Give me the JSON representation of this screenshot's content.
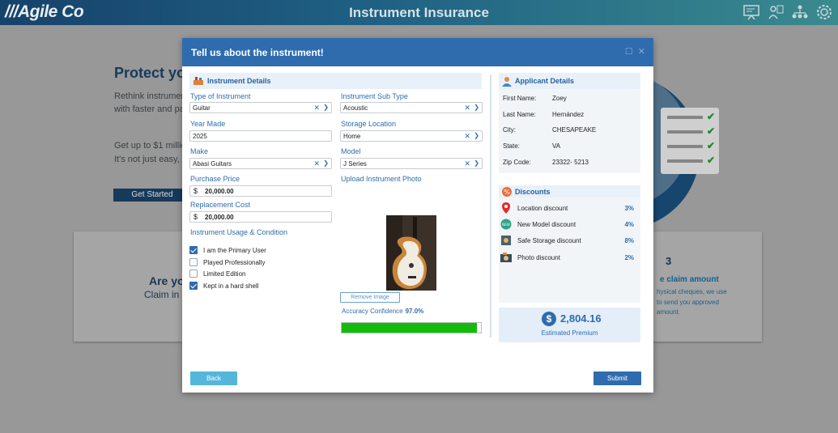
{
  "app": {
    "logo": "///Agile Co",
    "title": "Instrument Insurance"
  },
  "background": {
    "hero_title": "Protect yo",
    "hero_line1": "Rethink instrumer",
    "hero_line2": "with faster and pa",
    "hero_line3": "Get up to $1 millic",
    "hero_line4": "It's not just easy, i",
    "cta": "Get Started",
    "card_title": "Are yo",
    "card_sub": "Claim in",
    "step_num": "3",
    "step_title": "e claim amount",
    "step_line1": "hysical cheques, we use",
    "step_line2": "to send you approved",
    "step_line3": "amount."
  },
  "modal": {
    "title": "Tell us about the instrument!",
    "details": {
      "heading": "Instrument Details",
      "type_label": "Type of Instrument",
      "type_value": "Guitar",
      "subtype_label": "Instrument Sub Type",
      "subtype_value": "Acoustic",
      "year_label": "Year Made",
      "year_value": "2025",
      "storage_label": "Storage Location",
      "storage_value": "Home",
      "make_label": "Make",
      "make_value": "Abasi Guitars",
      "model_label": "Model",
      "model_value": "J Series",
      "purchase_label": "Purchase Price",
      "purchase_currency": "$",
      "purchase_value": "20,000.00",
      "replacement_label": "Replacement Cost",
      "replacement_currency": "$",
      "replacement_value": "20,000.00",
      "upload_label": "Upload Instrument Photo",
      "usage_label": "Instrument Usage & Condition",
      "checks": [
        {
          "label": "I am the Primary User",
          "checked": true
        },
        {
          "label": "Played Professionally",
          "checked": false
        },
        {
          "label": "Limited Edition",
          "checked": false
        },
        {
          "label": "Kept in a hard shell",
          "checked": true
        }
      ],
      "remove_image": "Remove Image",
      "accuracy_label": "Accuracy Confidence",
      "accuracy_value": "97.0%",
      "accuracy_fraction": 0.97
    },
    "applicant": {
      "heading": "Applicant Details",
      "first_name_label": "First Name:",
      "first_name": "Zoey",
      "last_name_label": "Last Name:",
      "last_name": "Hernández",
      "city_label": "City:",
      "city": "CHESAPEAKE",
      "state_label": "State:",
      "state": "VA",
      "zip_label": "Zip Code:",
      "zip": "23322- 5213"
    },
    "discounts": {
      "heading": "Discounts",
      "items": [
        {
          "name": "Location discount",
          "pct": "3%",
          "icon": "location-pin-icon"
        },
        {
          "name": "New Model discount",
          "pct": "4%",
          "icon": "new-badge-icon"
        },
        {
          "name": "Safe Storage discount",
          "pct": "8%",
          "icon": "safe-icon"
        },
        {
          "name": "Photo discount",
          "pct": "2%",
          "icon": "camera-icon"
        }
      ]
    },
    "premium": {
      "amount": "2,804.16",
      "label": "Estimated Premium"
    },
    "back": "Back",
    "submit": "Submit"
  }
}
